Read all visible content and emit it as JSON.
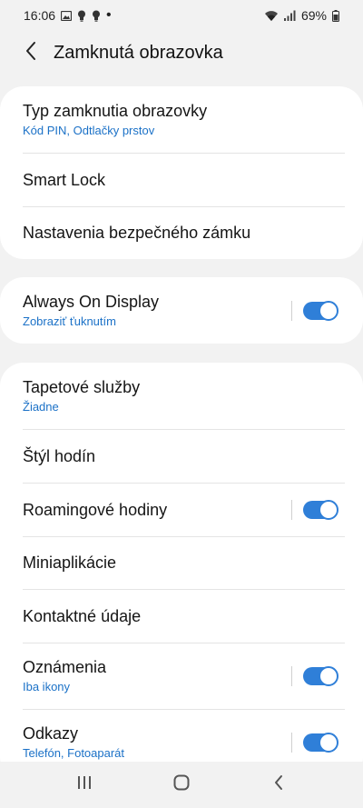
{
  "status": {
    "time": "16:06",
    "battery": "69%",
    "dot": "•"
  },
  "app_bar": {
    "title": "Zamknutá obrazovka"
  },
  "groups": {
    "g1": [
      {
        "title": "Typ zamknutia obrazovky",
        "subtitle": "Kód PIN, Odtlačky prstov"
      },
      {
        "title": "Smart Lock"
      },
      {
        "title": "Nastavenia bezpečného zámku"
      }
    ],
    "g2": [
      {
        "title": "Always On Display",
        "subtitle": "Zobraziť ťuknutím",
        "toggle": "on"
      }
    ],
    "g3": [
      {
        "title": "Tapetové služby",
        "subtitle": "Žiadne"
      },
      {
        "title": "Štýl hodín"
      },
      {
        "title": "Roamingové hodiny",
        "toggle": "on"
      },
      {
        "title": "Miniaplikácie"
      },
      {
        "title": "Kontaktné údaje"
      },
      {
        "title": "Oznámenia",
        "subtitle": "Iba ikony",
        "toggle": "on"
      },
      {
        "title": "Odkazy",
        "subtitle": "Telefón, Fotoaparát",
        "toggle": "on"
      }
    ]
  },
  "icons": {
    "back": "chevron-left-icon",
    "recents": "recents-icon",
    "home": "home-icon",
    "nav_back": "nav-back-icon"
  },
  "colors": {
    "accent": "#2f7fd8",
    "subtitle": "#1b71c7",
    "background": "#f2f2f2",
    "card": "#ffffff"
  }
}
